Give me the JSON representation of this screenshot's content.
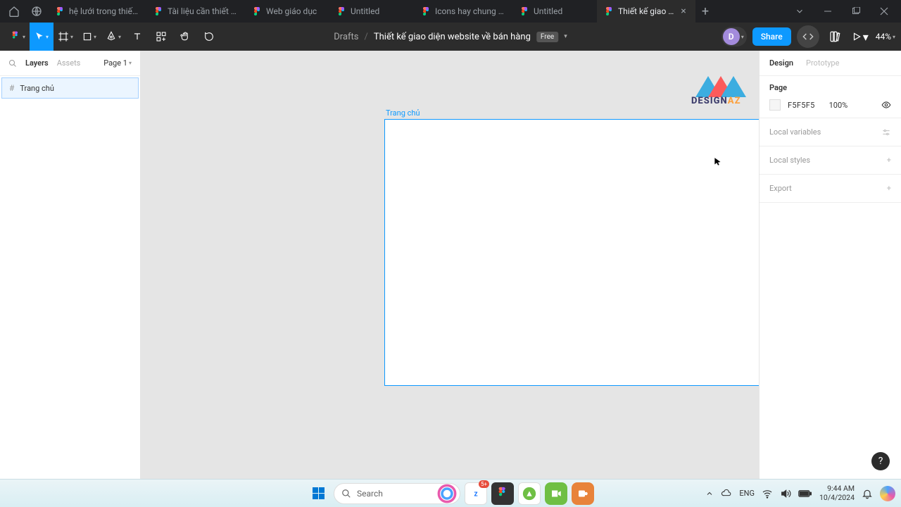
{
  "browser": {
    "tabs": [
      {
        "label": "hệ lưới trong thiết kế fig"
      },
      {
        "label": "Tài liệu cần thiết cho th"
      },
      {
        "label": "Web giáo dục"
      },
      {
        "label": "Untitled"
      },
      {
        "label": "Icons hay chung hết"
      },
      {
        "label": "Untitled"
      },
      {
        "label": "Thiết kế giao diện we"
      }
    ]
  },
  "figma": {
    "drafts": "Drafts",
    "file_name": "Thiết kế giao diện website về bán hàng",
    "plan_badge": "Free",
    "share": "Share",
    "zoom": "44%",
    "avatar_initial": "D"
  },
  "left": {
    "layers_tab": "Layers",
    "assets_tab": "Assets",
    "page_selector": "Page 1",
    "layer_name": "Trang chủ"
  },
  "canvas": {
    "frame_label": "Trang chủ"
  },
  "right": {
    "design_tab": "Design",
    "prototype_tab": "Prototype",
    "page_title": "Page",
    "bg_hex": "F5F5F5",
    "bg_opacity": "100%",
    "local_variables": "Local variables",
    "local_styles": "Local styles",
    "export": "Export"
  },
  "watermark": {
    "text1": "DESIGN",
    "text2": "AZ"
  },
  "taskbar": {
    "search_placeholder": "Search",
    "lang": "ENG",
    "time": "9:44 AM",
    "date": "10/4/2024",
    "app_badge": "5+"
  }
}
